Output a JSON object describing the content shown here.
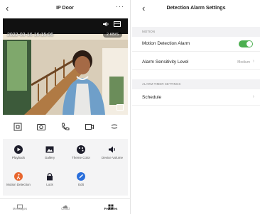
{
  "left_screen": {
    "header": {
      "title": "IP Door",
      "back_icon": "chevron-left-icon",
      "more_icon": "more-dots-icon"
    },
    "video": {
      "timestamp": "2022-03-16 16:15:06",
      "bitrate": "2 KB/S",
      "top_icons": [
        "speaker-icon",
        "layout-icon"
      ],
      "fullscreen_icon": "fullscreen-icon"
    },
    "controls": [
      "screenshot-icon",
      "camera-icon",
      "phone-icon",
      "record-icon",
      "more-chevron-icon"
    ],
    "features": [
      {
        "label": "Playback",
        "icon": "play-icon",
        "color": "#1d1d2b"
      },
      {
        "label": "Gallery",
        "icon": "gallery-icon",
        "color": "#1d1d2b"
      },
      {
        "label": "Theme Color",
        "icon": "palette-icon",
        "color": "#1d1d2b"
      },
      {
        "label": "Device Volume",
        "icon": "volume-icon",
        "color": "#1d1d2b"
      },
      {
        "label": "Motion Detection",
        "icon": "motion-icon",
        "color": "#e8662e"
      },
      {
        "label": "Lock",
        "icon": "lock-icon",
        "color": "#1d1d2b"
      },
      {
        "label": "Edit",
        "icon": "edit-icon",
        "color": "#2a6fdb"
      }
    ],
    "tabs": [
      {
        "label": "Messages",
        "icon": "message-icon",
        "active": false
      },
      {
        "label": "Cloud",
        "icon": "cloud-icon",
        "active": false
      },
      {
        "label": "Features",
        "icon": "grid-icon",
        "active": true
      }
    ]
  },
  "right_screen": {
    "header": {
      "title": "Detection Alarm Settings",
      "back_icon": "chevron-left-icon"
    },
    "section_motion": "MOTION",
    "motion_alarm": {
      "label": "Motion Detection Alarm",
      "enabled": true,
      "toggle_color": "#4caf50"
    },
    "sensitivity": {
      "label": "Alarm Sensitivity Level",
      "value": "Medium"
    },
    "section_timer": "ALARM TIMER SETTINGS",
    "schedule": {
      "label": "Schedule"
    }
  }
}
